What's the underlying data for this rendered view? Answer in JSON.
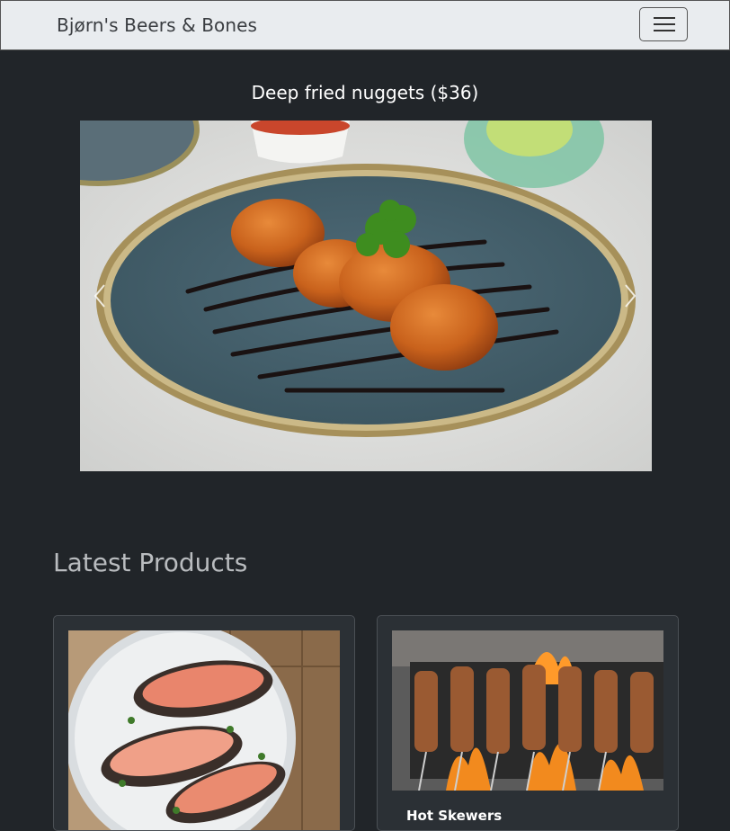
{
  "navbar": {
    "brand": "Bjørn's Beers & Bones",
    "toggler_icon": "hamburger-icon"
  },
  "carousel": {
    "caption": "Deep fried nuggets ($36)",
    "prev_icon": "chevron-left-icon",
    "next_icon": "chevron-right-icon"
  },
  "latest": {
    "title": "Latest Products",
    "products": [
      {
        "name": ""
      },
      {
        "name": "Hot Skewers"
      }
    ]
  },
  "colors": {
    "page_bg": "#212529",
    "navbar_bg": "#e9ecef",
    "card_bg": "#2b3035"
  }
}
